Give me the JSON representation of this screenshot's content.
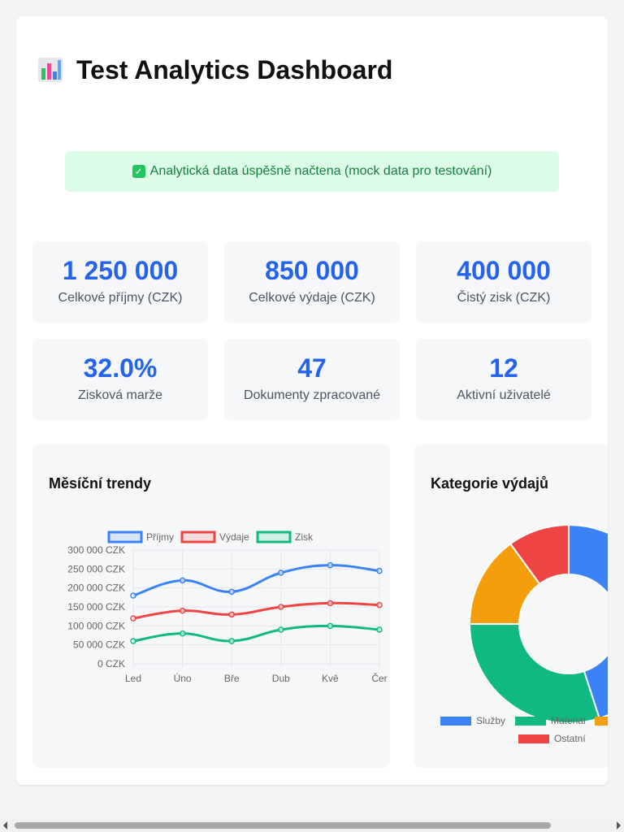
{
  "page": {
    "title": "Test Analytics Dashboard",
    "title_icon": "bar-chart-icon"
  },
  "alert": {
    "icon": "check-mark-icon",
    "message": "Analytická data úspěšně načtena (mock data pro testování)"
  },
  "stats": [
    {
      "value": "1 250 000",
      "label": "Celkové příjmy (CZK)"
    },
    {
      "value": "850 000",
      "label": "Celkové výdaje (CZK)"
    },
    {
      "value": "400 000",
      "label": "Čistý zisk (CZK)"
    },
    {
      "value": "32.0%",
      "label": "Zisková marže"
    },
    {
      "value": "47",
      "label": "Dokumenty zpracované"
    },
    {
      "value": "12",
      "label": "Aktivní uživatelé"
    }
  ],
  "trends": {
    "title": "Měsíční trendy"
  },
  "categories": {
    "title": "Kategorie výdajů"
  },
  "colors": {
    "blue": "#3b82f6",
    "red": "#ef4444",
    "green": "#10b981",
    "orange": "#f59e0b",
    "accent": "#2563eb"
  },
  "chart_data": [
    {
      "type": "line",
      "title": "Měsíční trendy",
      "categories": [
        "Led",
        "Úno",
        "Bře",
        "Dub",
        "Kvě",
        "Čer"
      ],
      "y_ticks": [
        "300 000 CZK",
        "250 000 CZK",
        "200 000 CZK",
        "150 000 CZK",
        "100 000 CZK",
        "50 000 CZK",
        "0 CZK"
      ],
      "ylim": [
        0,
        300000
      ],
      "grid": true,
      "legend": "top",
      "series": [
        {
          "name": "Příjmy",
          "color": "#3b82f6",
          "values": [
            180000,
            220000,
            190000,
            240000,
            260000,
            245000
          ]
        },
        {
          "name": "Výdaje",
          "color": "#ef4444",
          "values": [
            120000,
            140000,
            130000,
            150000,
            160000,
            155000
          ]
        },
        {
          "name": "Zisk",
          "color": "#10b981",
          "values": [
            60000,
            80000,
            60000,
            90000,
            100000,
            90000
          ]
        }
      ]
    },
    {
      "type": "pie",
      "title": "Kategorie výdajů",
      "legend": "bottom",
      "slices": [
        {
          "name": "Služby",
          "color": "#3b82f6",
          "value": 45
        },
        {
          "name": "Materiál",
          "color": "#10b981",
          "value": 30
        },
        {
          "name": "",
          "color": "#f59e0b",
          "value": 15
        },
        {
          "name": "Ostatní",
          "color": "#ef4444",
          "value": 10
        }
      ]
    }
  ]
}
